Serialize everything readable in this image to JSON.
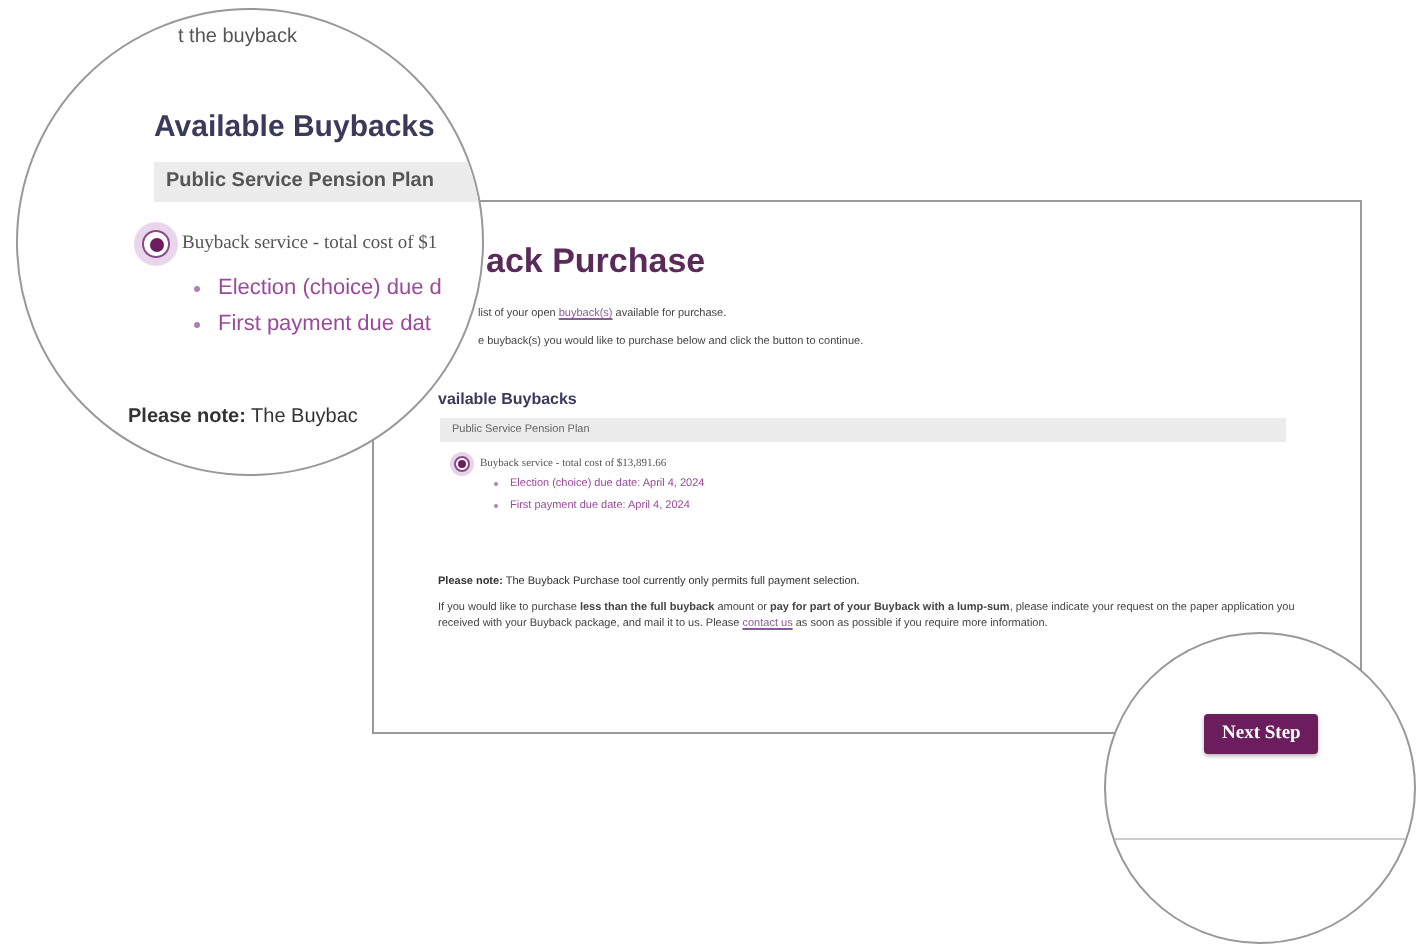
{
  "magnifier_top": {
    "cut_text": "t the buyback",
    "heading": "Available Buybacks",
    "plan": "Public Service Pension Plan",
    "option": {
      "label": "Buyback service - total cost of $1",
      "selected": true
    },
    "dates": [
      "Election (choice) due d",
      "First payment due dat"
    ],
    "note": "**Please note:** The Buybac"
  },
  "page": {
    "title": "ack Purchase",
    "intro_1": {
      "before": "list of your open",
      "link": "buyback(s)",
      "after": "available for purchase."
    },
    "intro_2": "e buyback(s) you would like to purchase below and click the button to continue.",
    "heading": "vailable Buybacks",
    "plan": "Public Service Pension Plan",
    "option": {
      "label": "Buyback service - total cost of $13,891.66",
      "selected": true
    },
    "dates": [
      "Election (choice) due date: April 4, 2024",
      "First payment due date: April 4, 2024"
    ],
    "note": "**Please note:** The Buyback Purchase tool currently only permits full payment selection.",
    "info": {
      "before": "If you would like to purchase **less than the full buyback** amount or **pay for part of your Buyback with a lump-sum**, please indicate your request on the paper application you received with your Buyback package, and mail it to us. Please",
      "link": "contact us",
      "after": "as soon as possible if you require more information."
    }
  },
  "magnifier_bottom": {
    "button": "Next Step"
  }
}
